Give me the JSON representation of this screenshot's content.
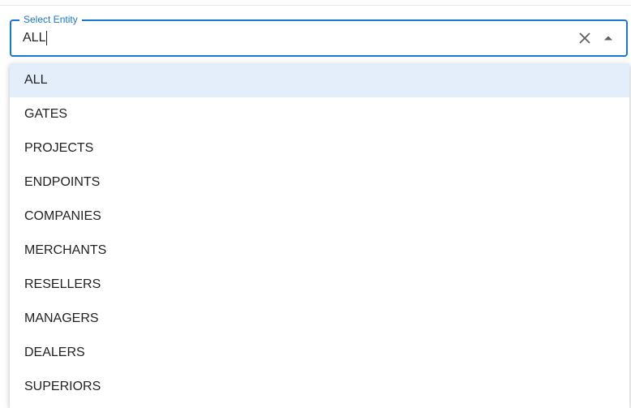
{
  "field": {
    "label": "Select Entity",
    "value": "ALL"
  },
  "icons": {
    "clear": "close-icon",
    "toggle": "arrow-up-icon"
  },
  "colors": {
    "accent": "#1976d2",
    "selected_option_bg": "#e4eefb"
  },
  "options": [
    {
      "label": "ALL",
      "selected": true
    },
    {
      "label": "GATES"
    },
    {
      "label": "PROJECTS"
    },
    {
      "label": "ENDPOINTS"
    },
    {
      "label": "COMPANIES"
    },
    {
      "label": "MERCHANTS"
    },
    {
      "label": "RESELLERS"
    },
    {
      "label": "MANAGERS"
    },
    {
      "label": "DEALERS"
    },
    {
      "label": "SUPERIORS"
    }
  ]
}
